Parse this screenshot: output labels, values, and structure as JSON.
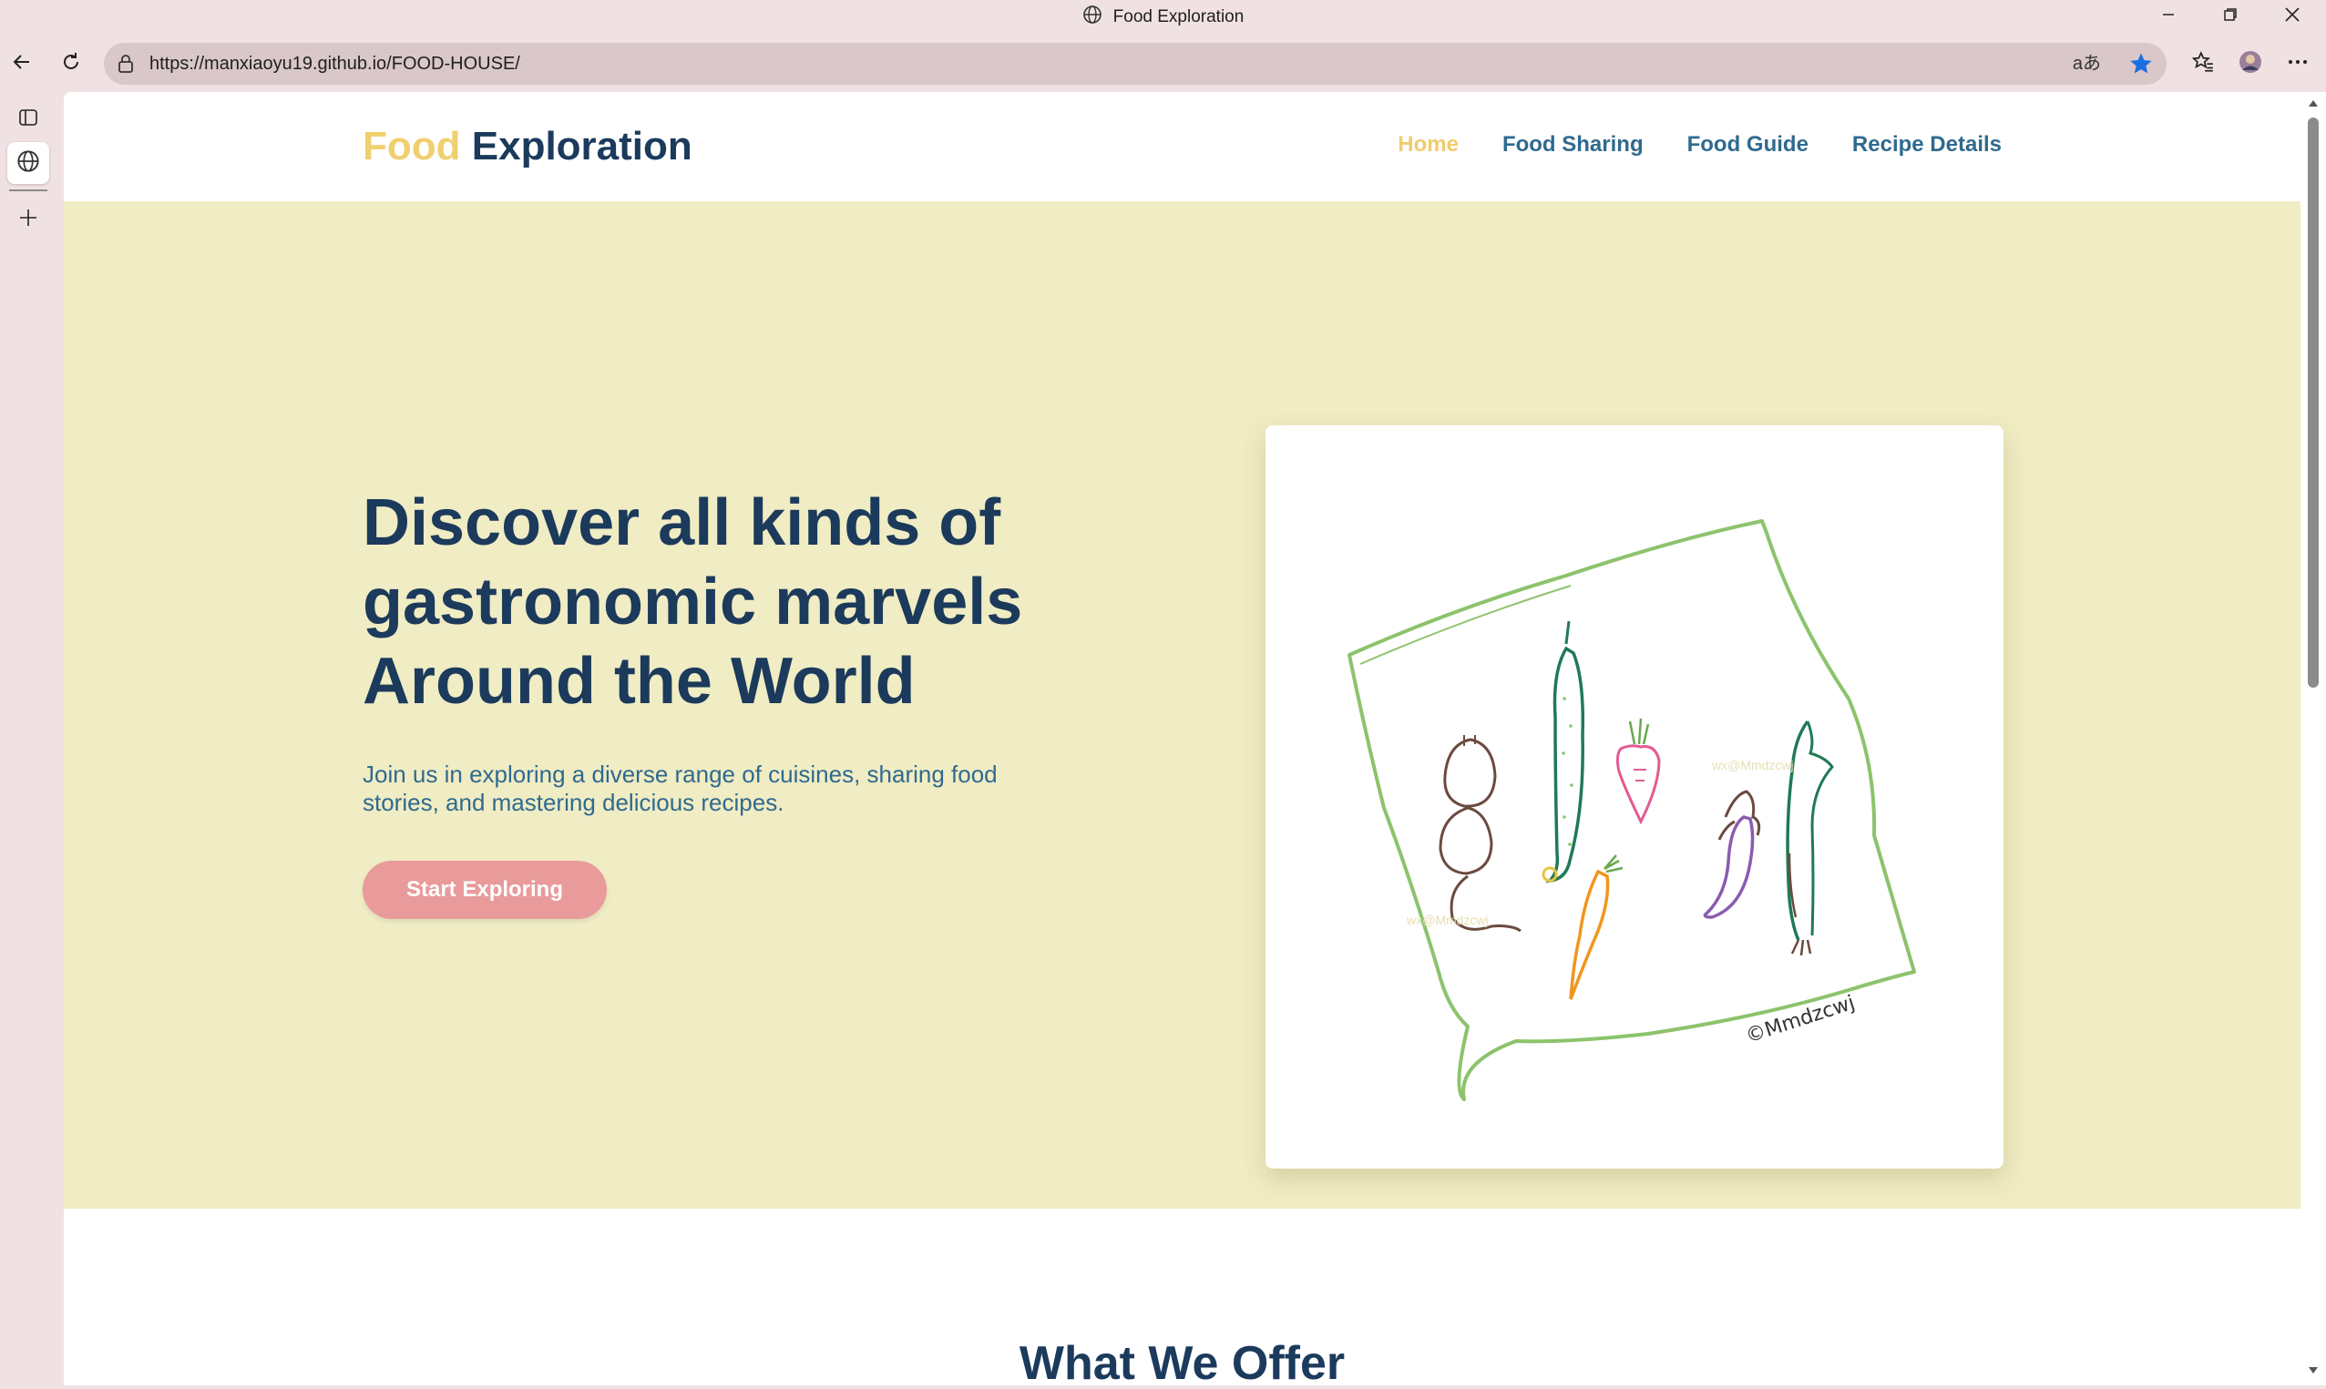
{
  "browser": {
    "tab_title": "Food Exploration",
    "url": "https://manxiaoyu19.github.io/FOOD-HOUSE/",
    "read_aloud_label": "aあ",
    "icons": [
      "globe-icon",
      "back-icon",
      "refresh-icon",
      "lock-icon",
      "star-icon",
      "favorites-icon",
      "profile-icon",
      "more-icon",
      "minimize-icon",
      "restore-icon",
      "close-icon",
      "tab-actions-icon",
      "new-tab-icon"
    ]
  },
  "site": {
    "logo_part1": "Food",
    "logo_part2": "Exploration",
    "nav": [
      {
        "label": "Home",
        "current": true
      },
      {
        "label": "Food Sharing",
        "current": false
      },
      {
        "label": "Food Guide",
        "current": false
      },
      {
        "label": "Recipe Details",
        "current": false
      }
    ]
  },
  "hero": {
    "title_line1": "Discover all kinds of",
    "title_line2": "gastronomic marvels",
    "title_line3": "Around the World",
    "subtitle": "Join us in exploring a diverse range of cuisines, sharing food stories, and mastering delicious recipes.",
    "cta": "Start Exploring",
    "image_signature": "©Mmdzcwj"
  },
  "offer": {
    "title": "What We Offer"
  },
  "colors": {
    "logo_accent": "#f0d06e",
    "navy": "#1b3a5c",
    "link_blue": "#2f6a8f",
    "hero_bg": "#f0ecc3",
    "button_pink": "#e99a9a",
    "browser_frame": "#f0e1e3"
  }
}
